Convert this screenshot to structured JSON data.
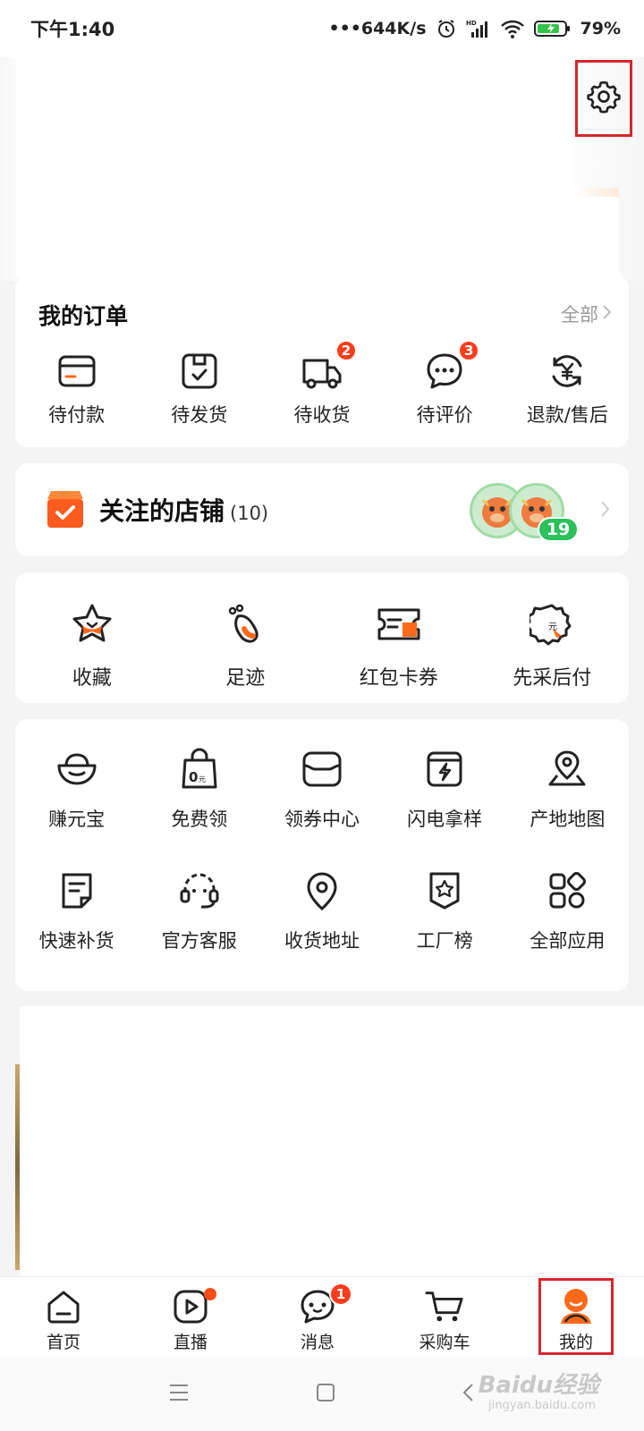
{
  "status_bar": {
    "time": "下午1:40",
    "network_speed": "•••644K/s",
    "battery_percent": "79%"
  },
  "orders": {
    "title": "我的订单",
    "all_label": "全部",
    "items": [
      {
        "label": "待付款",
        "icon": "wallet-card-icon"
      },
      {
        "label": "待发货",
        "icon": "package-box-icon"
      },
      {
        "label": "待收货",
        "icon": "delivery-truck-icon",
        "badge": "2"
      },
      {
        "label": "待评价",
        "icon": "chat-bubble-icon",
        "badge": "3"
      },
      {
        "label": "退款/售后",
        "icon": "refund-yen-icon"
      }
    ]
  },
  "shops": {
    "title": "关注的店铺",
    "count": "(10)",
    "badge": "19"
  },
  "favorites": {
    "items": [
      {
        "label": "收藏",
        "icon": "star-icon"
      },
      {
        "label": "足迹",
        "icon": "footprint-icon"
      },
      {
        "label": "红包卡券",
        "icon": "coupon-icon"
      },
      {
        "label": "先采后付",
        "icon": "pay-later-badge-icon"
      }
    ]
  },
  "tools": {
    "items": [
      {
        "label": "赚元宝",
        "icon": "gold-ingot-icon"
      },
      {
        "label": "免费领",
        "icon": "free-bag-icon"
      },
      {
        "label": "领券中心",
        "icon": "coupon-center-icon"
      },
      {
        "label": "闪电拿样",
        "icon": "lightning-sample-icon"
      },
      {
        "label": "产地地图",
        "icon": "origin-map-icon"
      },
      {
        "label": "快速补货",
        "icon": "restock-note-icon"
      },
      {
        "label": "官方客服",
        "icon": "headset-icon"
      },
      {
        "label": "收货地址",
        "icon": "location-pin-icon"
      },
      {
        "label": "工厂榜",
        "icon": "factory-rank-icon"
      },
      {
        "label": "全部应用",
        "icon": "all-apps-icon"
      }
    ]
  },
  "tab_bar": {
    "items": [
      {
        "label": "首页",
        "icon": "home-icon"
      },
      {
        "label": "直播",
        "icon": "live-play-icon"
      },
      {
        "label": "消息",
        "icon": "message-icon",
        "badge": "1"
      },
      {
        "label": "采购车",
        "icon": "cart-icon"
      },
      {
        "label": "我的",
        "icon": "profile-avatar-icon"
      }
    ]
  },
  "watermark": {
    "brand": "Baidu经验",
    "site": "jingyan.baidu.com"
  },
  "colors": {
    "accent_orange": "#ff6a1a",
    "badge_red": "#ff3d1c",
    "highlight_red": "#d6262d",
    "shop_green": "#2cc15b"
  }
}
